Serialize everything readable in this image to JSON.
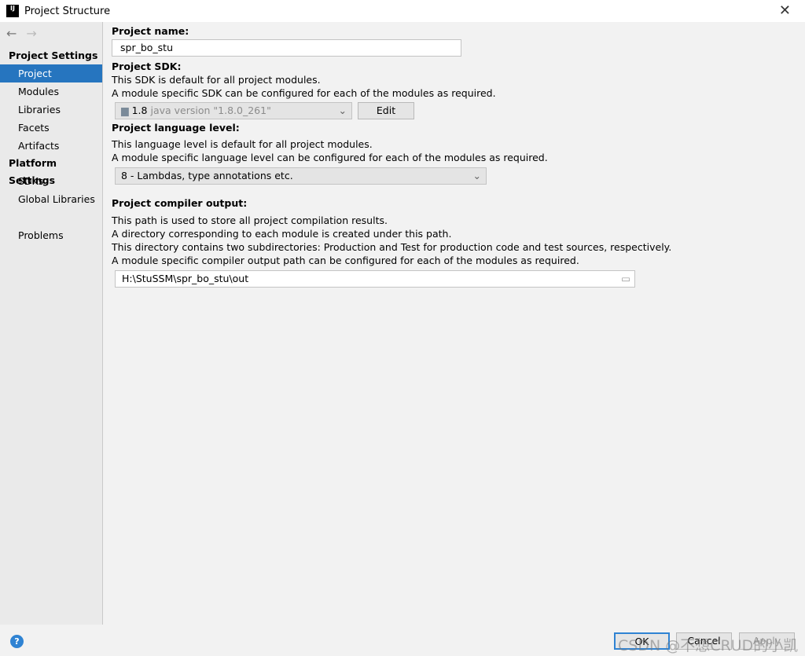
{
  "window": {
    "title": "Project Structure",
    "logo": "IJ"
  },
  "sidebar": {
    "sections": [
      {
        "title": "Project Settings",
        "items": [
          "Project",
          "Modules",
          "Libraries",
          "Facets",
          "Artifacts"
        ]
      },
      {
        "title": "Platform Settings",
        "items": [
          "SDKs",
          "Global Libraries"
        ]
      }
    ],
    "extra": "Problems",
    "selected": "Project"
  },
  "main": {
    "name_label": "Project name:",
    "name_value": "spr_bo_stu",
    "sdk_label": "Project SDK:",
    "sdk_desc1": "This SDK is default for all project modules.",
    "sdk_desc2": "A module specific SDK can be configured for each of the modules as required.",
    "sdk_version": "1.8",
    "sdk_detail": "java version \"1.8.0_261\"",
    "edit_label": "Edit",
    "lang_label": "Project language level:",
    "lang_desc1": "This language level is default for all project modules.",
    "lang_desc2": "A module specific language level can be configured for each of the modules as required.",
    "lang_value": "8 - Lambdas, type annotations etc.",
    "out_label": "Project compiler output:",
    "out_desc1": "This path is used to store all project compilation results.",
    "out_desc2": "A directory corresponding to each module is created under this path.",
    "out_desc3": "This directory contains two subdirectories: Production and Test for production code and test sources, respectively.",
    "out_desc4": "A module specific compiler output path can be configured for each of the modules as required.",
    "out_value": "H:\\StuSSM\\spr_bo_stu\\out"
  },
  "footer": {
    "help": "?",
    "ok": "OK",
    "cancel": "Cancel",
    "apply": "Apply"
  },
  "watermark": "CSDN @不想CRUD的小凯"
}
